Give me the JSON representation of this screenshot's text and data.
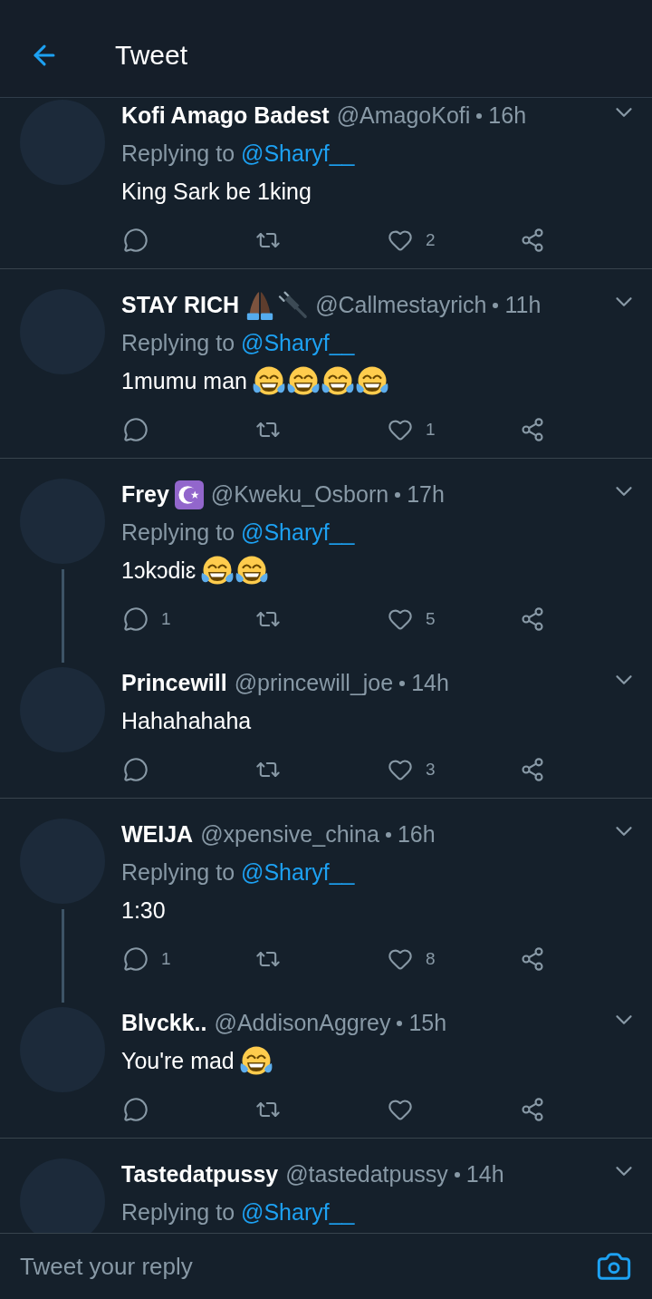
{
  "header": {
    "title": "Tweet"
  },
  "conversations": [
    {
      "tweets": [
        {
          "name": "Kofi Amago Badest",
          "handle": "@AmagoKofi",
          "time": "16h",
          "replying_label": "Replying to",
          "replying_handle": "@Sharyf__",
          "text": "King Sark be 1king",
          "actions": [
            {
              "kind": "reply"
            },
            {
              "kind": "retweet"
            },
            {
              "kind": "like",
              "count": "2"
            },
            {
              "kind": "share"
            }
          ]
        }
      ]
    },
    {
      "tweets": [
        {
          "name": "STAY RICH",
          "name_emojis": [
            {
              "kind": "folded-hands"
            },
            {
              "kind": "plug"
            }
          ],
          "handle": "@Callmestayrich",
          "time": "11h",
          "replying_label": "Replying to",
          "replying_handle": "@Sharyf__",
          "text": "1mumu man",
          "text_emojis": [
            {
              "kind": "tears-of-joy"
            },
            {
              "kind": "tears-of-joy"
            },
            {
              "kind": "tears-of-joy"
            },
            {
              "kind": "tears-of-joy"
            }
          ],
          "actions": [
            {
              "kind": "reply"
            },
            {
              "kind": "retweet"
            },
            {
              "kind": "like",
              "count": "1"
            },
            {
              "kind": "share"
            }
          ]
        }
      ]
    },
    {
      "tweets": [
        {
          "name": "Frey",
          "name_emojis": [
            {
              "kind": "star-and-crescent"
            }
          ],
          "handle": "@Kweku_Osborn",
          "time": "17h",
          "replying_label": "Replying to",
          "replying_handle": "@Sharyf__",
          "text": "1ɔkɔdiɛ",
          "text_emojis": [
            {
              "kind": "tears-of-joy"
            },
            {
              "kind": "tears-of-joy"
            }
          ],
          "actions": [
            {
              "kind": "reply",
              "count": "1"
            },
            {
              "kind": "retweet"
            },
            {
              "kind": "like",
              "count": "5"
            },
            {
              "kind": "share"
            }
          ]
        },
        {
          "name": "Princewill",
          "handle": "@princewill_joe",
          "time": "14h",
          "text": "Hahahahaha",
          "actions": [
            {
              "kind": "reply"
            },
            {
              "kind": "retweet"
            },
            {
              "kind": "like",
              "count": "3"
            },
            {
              "kind": "share"
            }
          ]
        }
      ]
    },
    {
      "tweets": [
        {
          "name": "WEIJA",
          "handle": "@xpensive_china",
          "time": "16h",
          "replying_label": "Replying to",
          "replying_handle": "@Sharyf__",
          "text": "1:30",
          "actions": [
            {
              "kind": "reply",
              "count": "1"
            },
            {
              "kind": "retweet"
            },
            {
              "kind": "like",
              "count": "8"
            },
            {
              "kind": "share"
            }
          ]
        },
        {
          "name": "Blvckk..",
          "handle": "@AddisonAggrey",
          "time": "15h",
          "text": "You're mad",
          "text_emojis": [
            {
              "kind": "tears-of-joy"
            }
          ],
          "actions": [
            {
              "kind": "reply"
            },
            {
              "kind": "retweet"
            },
            {
              "kind": "like"
            },
            {
              "kind": "share"
            }
          ]
        }
      ]
    },
    {
      "tweets": [
        {
          "name": "Tastedatpussy",
          "handle": "@tastedatpussy",
          "time": "14h",
          "replying_label": "Replying to",
          "replying_handle": "@Sharyf__"
        }
      ]
    }
  ],
  "reply_bar": {
    "placeholder": "Tweet your reply"
  }
}
